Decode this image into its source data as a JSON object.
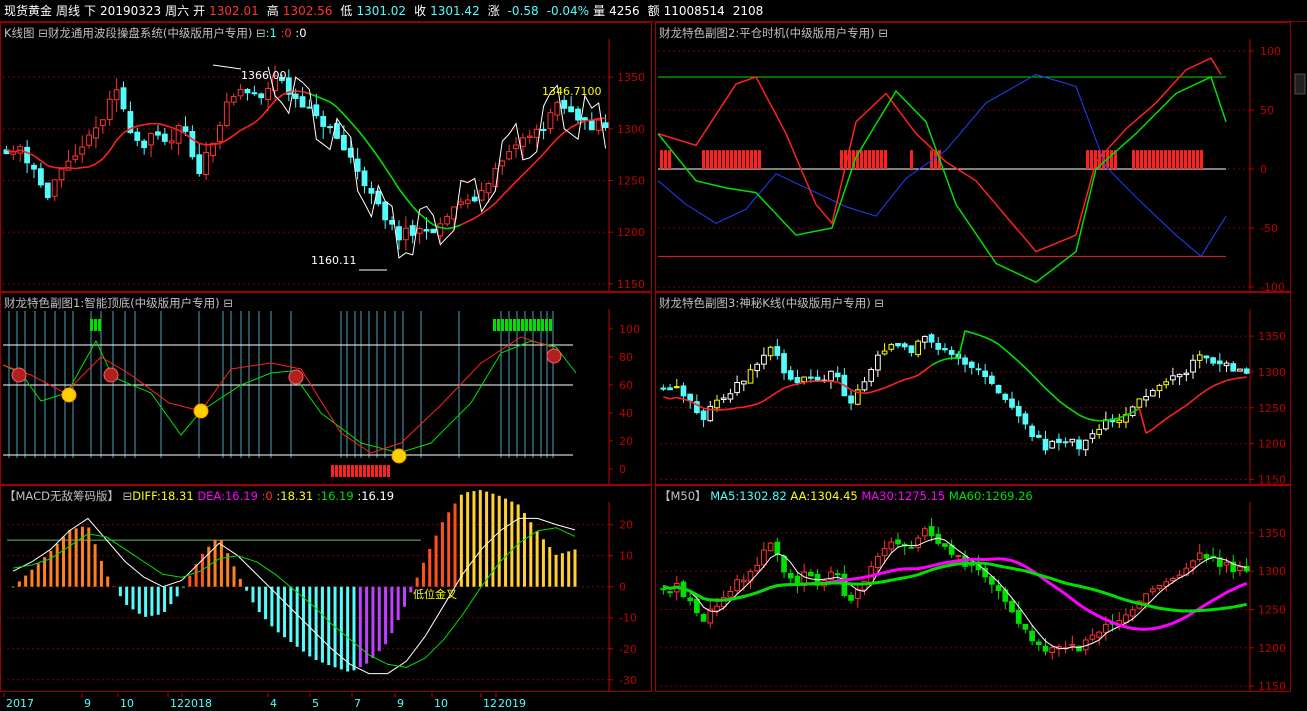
{
  "header": {
    "name": "现货黄金",
    "period": "周线",
    "mode": "下",
    "date": "20190323",
    "weekday": "周六",
    "open_label": "开",
    "open_value": "1302.01",
    "high_label": "高",
    "high_value": "1302.56",
    "low_label": "低",
    "low_value": "1301.02",
    "close_label": "收",
    "close_value": "1301.42",
    "change_label": "涨",
    "change_value": "-0.58",
    "change_pct": "-0.04%",
    "volume_label": "量",
    "volume_value": "4256",
    "amount_label": "额",
    "amount_value": "11008514",
    "extra": "2108"
  },
  "colors": {
    "up": "#ff3232",
    "down": "#54fcfc",
    "grid": "#800000",
    "axis": "#c00000",
    "green": "#00e000",
    "yellow": "#ffff00",
    "magenta": "#ff00ff",
    "white": "#ffffff"
  },
  "panels": {
    "kline": {
      "title": "K线图 ⊟财龙通用波段操盘系统(中级版用户专用) ⊟",
      "t1": ":1",
      "t2": ":0",
      "t3": ":0",
      "high_label": "1366.00",
      "low_label": "1160.11",
      "last_label": "1346.7100",
      "yticks": [
        "1350",
        "1300",
        "1250",
        "1200",
        "1150"
      ]
    },
    "sub1": {
      "title": "财龙特色副图1:智能顶底(中级版用户专用) ⊟",
      "yticks": [
        "100",
        "80",
        "60",
        "40",
        "20",
        "0"
      ]
    },
    "sub2": {
      "title": "财龙特色副图2:平仓时机(中级版用户专用) ⊟",
      "yticks": [
        "100",
        "50",
        "0",
        "-50",
        "-100"
      ]
    },
    "sub3": {
      "title": "财龙特色副图3:神秘K线(中级版用户专用) ⊟",
      "yticks": [
        "1350",
        "1300",
        "1250",
        "1200",
        "1150"
      ]
    },
    "macd": {
      "title": "【MACD无敌筹码版】 ⊟",
      "diff_label": "DIFF:18.31",
      "dea_label": "DEA:16.19",
      "v0": ":0",
      "v1": ":18.31",
      "v2": ":16.19",
      "v3": ":16.19",
      "annotation": "低位金叉",
      "yticks": [
        "20",
        "10",
        "0",
        "-10",
        "-20",
        "-30"
      ]
    },
    "ma": {
      "title": "【M50】",
      "ma5": "MA5:1302.82",
      "aa": "AA:1304.45",
      "ma30": "MA30:1275.15",
      "ma60": "MA60:1269.26",
      "yticks": [
        "1350",
        "1300",
        "1250",
        "1200",
        "1150"
      ]
    }
  },
  "xaxis": [
    "2017",
    "9",
    "10",
    "12",
    "2018",
    "4",
    "5",
    "7",
    "9",
    "10",
    "12",
    "2019"
  ],
  "chart_data": [
    {
      "type": "candlestick",
      "title": "K线图",
      "ylim": [
        1145,
        1385
      ],
      "ohlc_close_approx": [
        1280,
        1275,
        1283,
        1270,
        1262,
        1245,
        1235,
        1250,
        1258,
        1265,
        1272,
        1285,
        1290,
        1300,
        1310,
        1325,
        1335,
        1320,
        1300,
        1290,
        1285,
        1295,
        1290,
        1285,
        1288,
        1300,
        1296,
        1270,
        1260,
        1275,
        1290,
        1305,
        1322,
        1330,
        1338,
        1335,
        1332,
        1328,
        1340,
        1352,
        1345,
        1335,
        1330,
        1325,
        1318,
        1310,
        1305,
        1300,
        1290,
        1280,
        1272,
        1260,
        1248,
        1235,
        1225,
        1210,
        1205,
        1195,
        1200,
        1198,
        1202,
        1205,
        1196,
        1208,
        1215,
        1222,
        1230,
        1228,
        1232,
        1240,
        1250,
        1260,
        1268,
        1275,
        1285,
        1290,
        1292,
        1298,
        1302,
        1315,
        1322,
        1320,
        1315,
        1310,
        1312,
        1300,
        1305,
        1301
      ],
      "annotations": [
        "1366.00",
        "1160.11",
        "1346.7100"
      ]
    },
    {
      "type": "line",
      "title": "MACD",
      "series": [
        {
          "name": "DIFF",
          "values": [
            5,
            8,
            12,
            18,
            22,
            15,
            8,
            3,
            0,
            2,
            8,
            14,
            10,
            4,
            -2,
            -8,
            -14,
            -20,
            -25,
            -28,
            -28,
            -24,
            -16,
            -6,
            4,
            12,
            18,
            22,
            22,
            20,
            18.31
          ]
        },
        {
          "name": "DEA",
          "values": [
            6,
            7,
            9,
            13,
            17,
            16,
            12,
            8,
            4,
            3,
            5,
            9,
            10,
            8,
            4,
            -1,
            -6,
            -12,
            -17,
            -22,
            -25,
            -26,
            -23,
            -17,
            -9,
            0,
            8,
            14,
            18,
            19,
            16.19
          ]
        }
      ],
      "annotations": [
        "低位金叉"
      ],
      "ylim": [
        -32,
        26
      ]
    }
  ]
}
